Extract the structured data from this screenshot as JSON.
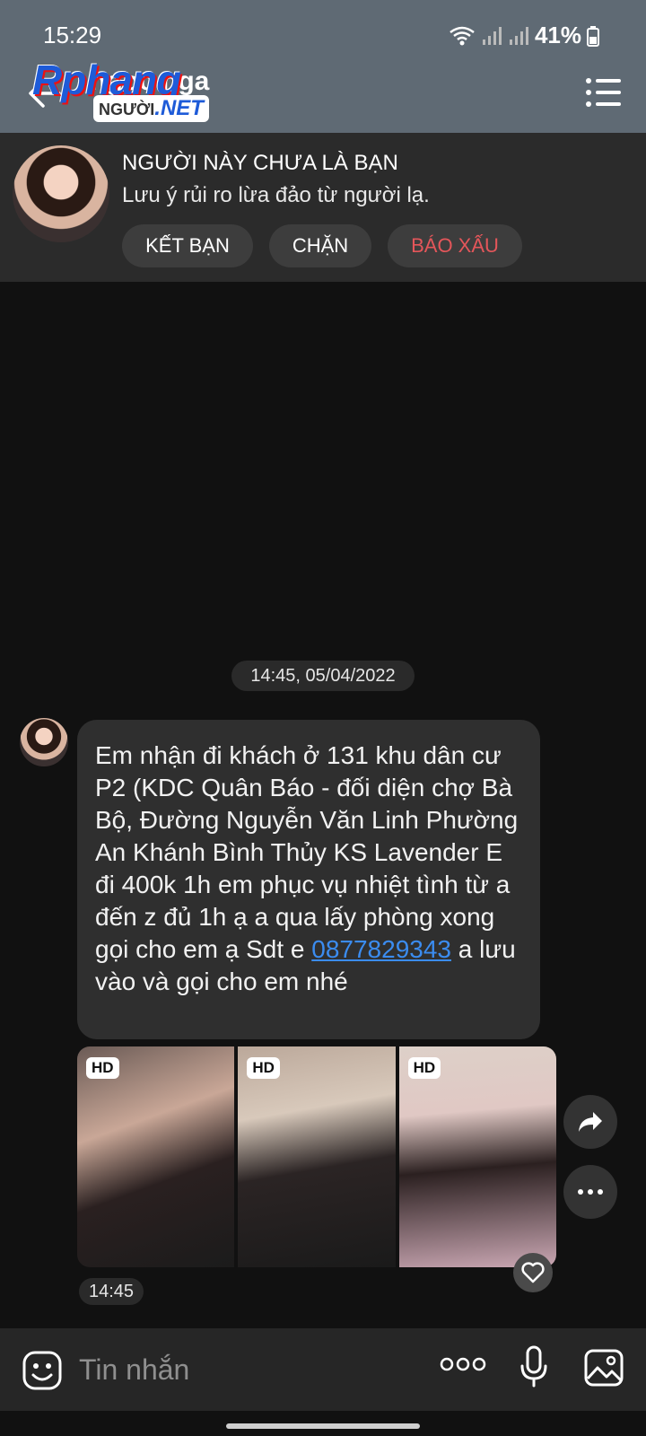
{
  "status_bar": {
    "time": "15:29",
    "battery": "41%"
  },
  "header": {
    "contact_name": "ngọc nga",
    "back_icon": "arrow-left-icon",
    "menu_icon": "list-menu-icon"
  },
  "watermark": {
    "brand": "Rphang",
    "sub_left": "NGƯỜI",
    "sub_right": ".NET"
  },
  "banner": {
    "title": "NGƯỜI NÀY CHƯA LÀ BẠN",
    "subtitle": "Lưu ý rủi ro lừa đảo từ người lạ.",
    "add_friend": "KẾT BẠN",
    "block": "CHẶN",
    "report": "BÁO XẤU",
    "report_color": "#e4565a"
  },
  "chat": {
    "date_separator": "14:45, 05/04/2022",
    "message": {
      "text_before": "Em nhận đi khách ở 131 khu dân cư P2 (KDC Quân Báo - đối diện chợ Bà Bộ, Đường Nguyễn Văn Linh Phường An Khánh Bình Thủy KS Lavender E đi 400k 1h em phục vụ nhiệt tình từ a đến z đủ 1h ạ a qua lấy phòng xong gọi cho em ạ  Sdt e ",
      "phone": "0877829343",
      "text_after": "  a lưu vào và gọi cho em nhé"
    },
    "photos": [
      {
        "badge": "HD"
      },
      {
        "badge": "HD"
      },
      {
        "badge": "HD"
      }
    ],
    "photo_time": "14:45"
  },
  "input": {
    "placeholder": "Tin nhắn"
  },
  "colors": {
    "header_bg": "#5f6a74",
    "link": "#3b8cf0",
    "bubble_bg": "#2f2f2f"
  }
}
